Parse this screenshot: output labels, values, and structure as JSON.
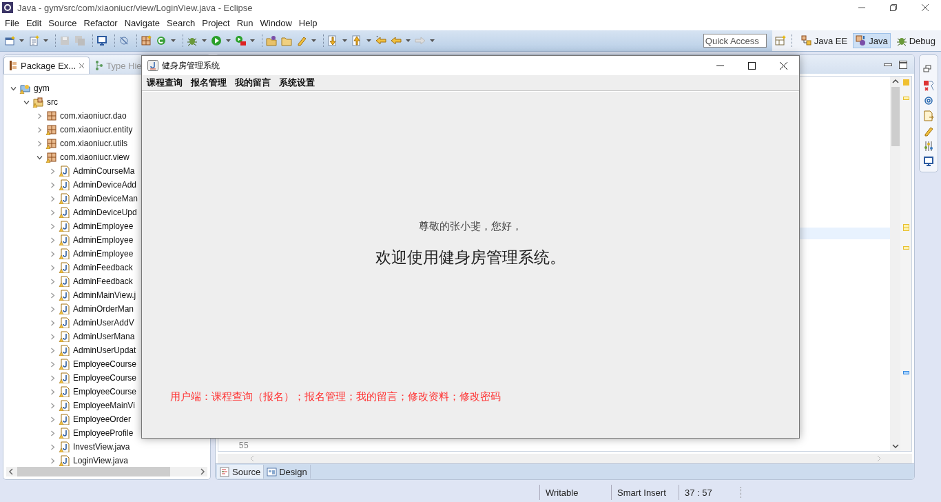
{
  "window": {
    "title": "Java - gym/src/com/xiaoniucr/view/LoginView.java - Eclipse"
  },
  "menu": [
    "File",
    "Edit",
    "Source",
    "Refactor",
    "Navigate",
    "Search",
    "Project",
    "Run",
    "Window",
    "Help"
  ],
  "toolbar": {
    "quick_access": {
      "placeholder": "Quick Access"
    },
    "perspectives": [
      {
        "label": "Java EE",
        "selected": false
      },
      {
        "label": "Java",
        "selected": true
      },
      {
        "label": "Debug",
        "selected": false
      }
    ]
  },
  "explorer": {
    "tabs": [
      {
        "label": "Package Ex...",
        "selected": true
      },
      {
        "label": "Type Hie",
        "selected": false
      }
    ],
    "tree": [
      {
        "label": "gym",
        "kind": "project",
        "expanded": true,
        "children": [
          {
            "label": "src",
            "kind": "source-folder",
            "expanded": true,
            "children": [
              {
                "label": "com.xiaoniucr.dao",
                "kind": "package",
                "expanded": false
              },
              {
                "label": "com.xiaoniucr.entity",
                "kind": "package",
                "expanded": false
              },
              {
                "label": "com.xiaoniucr.utils",
                "kind": "package",
                "expanded": false
              },
              {
                "label": "com.xiaoniucr.view",
                "kind": "package",
                "expanded": true,
                "children": [
                  {
                    "label": "AdminCourseMa",
                    "kind": "java-file",
                    "expanded": false
                  },
                  {
                    "label": "AdminDeviceAdd",
                    "kind": "java-file",
                    "expanded": false
                  },
                  {
                    "label": "AdminDeviceMan",
                    "kind": "java-file",
                    "expanded": false
                  },
                  {
                    "label": "AdminDeviceUpd",
                    "kind": "java-file",
                    "expanded": false
                  },
                  {
                    "label": "AdminEmployee",
                    "kind": "java-file",
                    "expanded": false
                  },
                  {
                    "label": "AdminEmployee",
                    "kind": "java-file",
                    "expanded": false
                  },
                  {
                    "label": "AdminEmployee",
                    "kind": "java-file",
                    "expanded": false
                  },
                  {
                    "label": "AdminFeedback",
                    "kind": "java-file",
                    "expanded": false
                  },
                  {
                    "label": "AdminFeedback",
                    "kind": "java-file",
                    "expanded": false
                  },
                  {
                    "label": "AdminMainView.j",
                    "kind": "java-file",
                    "expanded": false
                  },
                  {
                    "label": "AdminOrderMan",
                    "kind": "java-file",
                    "expanded": false
                  },
                  {
                    "label": "AdminUserAddV",
                    "kind": "java-file",
                    "expanded": false
                  },
                  {
                    "label": "AdminUserMana",
                    "kind": "java-file",
                    "expanded": false
                  },
                  {
                    "label": "AdminUserUpdat",
                    "kind": "java-file",
                    "expanded": false
                  },
                  {
                    "label": "EmployeeCourse",
                    "kind": "java-file",
                    "expanded": false
                  },
                  {
                    "label": "EmployeeCourse",
                    "kind": "java-file",
                    "expanded": false
                  },
                  {
                    "label": "EmployeeCourse",
                    "kind": "java-file",
                    "expanded": false
                  },
                  {
                    "label": "EmployeeMainVi",
                    "kind": "java-file",
                    "expanded": false
                  },
                  {
                    "label": "EmployeeOrder",
                    "kind": "java-file",
                    "expanded": false
                  },
                  {
                    "label": "EmployeeProfile",
                    "kind": "java-file",
                    "expanded": false
                  },
                  {
                    "label": "InvestView.java",
                    "kind": "java-file",
                    "expanded": false
                  },
                  {
                    "label": "LoginView.java",
                    "kind": "java-file",
                    "expanded": false
                  }
                ]
              }
            ]
          }
        ]
      }
    ]
  },
  "editor": {
    "line_number": "55",
    "tabs": [
      {
        "label": "Source",
        "selected": true
      },
      {
        "label": "Design",
        "selected": false
      }
    ]
  },
  "status_bar": [
    "Writable",
    "Smart Insert",
    "37 : 57"
  ],
  "dialog": {
    "title": "健身房管理系统",
    "menu": [
      "课程查询",
      "报名管理",
      "我的留言",
      "系统设置"
    ],
    "greeting": "尊敬的张小斐，您好，",
    "welcome": "欢迎使用健身房管理系统。",
    "note": "用户端：课程查询（报名）；报名管理；我的留言；修改资料；修改密码"
  }
}
